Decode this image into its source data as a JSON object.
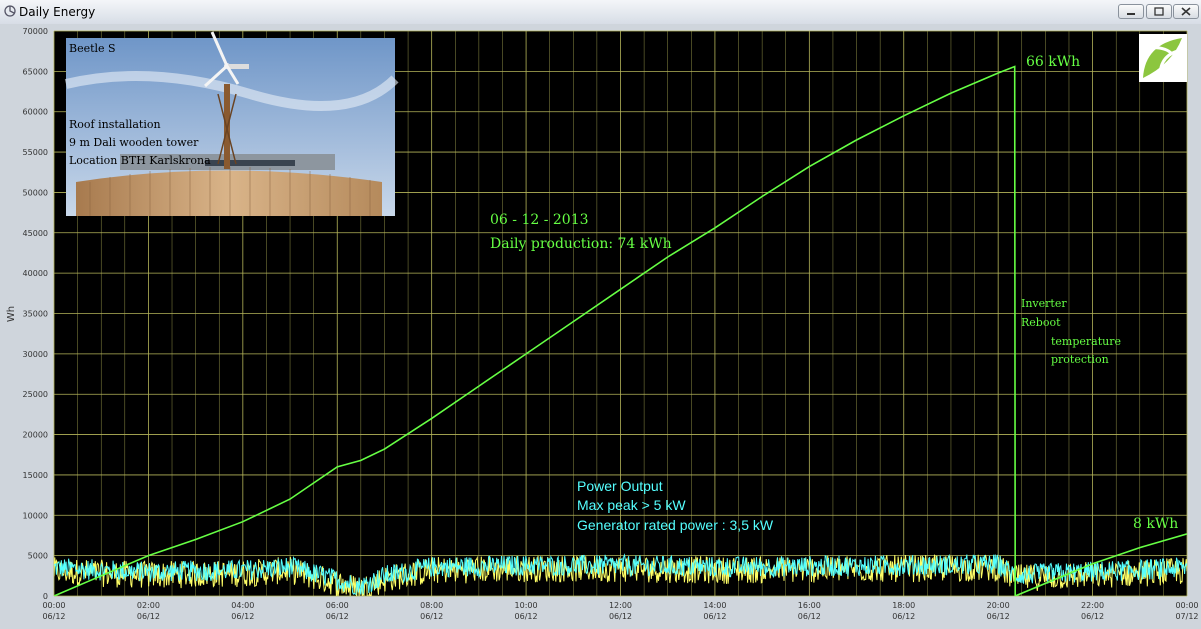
{
  "window": {
    "title": "Daily Energy",
    "minimize_icon": "minimize-icon",
    "maximize_icon": "maximize-icon",
    "close_icon": "close-icon"
  },
  "colors": {
    "plot_bg": "#000000",
    "grid": "#b5b55a",
    "energy_line": "#66ff44",
    "power_cyan": "#55ffff",
    "power_yellow": "#ffff66",
    "annotation_green": "#66ff44",
    "annotation_cyan": "#55ffff"
  },
  "photo": {
    "icon": "wind-turbine-photo",
    "caption_title": "Beetle S",
    "caption_lines": [
      "Roof installation",
      "9 m Dali wooden tower",
      "Location BTH Karlskrona"
    ]
  },
  "logo": {
    "icon": "leaf-logo-icon"
  },
  "annotations": {
    "date": "06 - 12 - 2013",
    "daily_production": "Daily production: 74 kWh",
    "peak_energy": "66 kWh",
    "end_energy": "8 kWh",
    "inverter": "Inverter",
    "reboot": "Reboot",
    "temperature": "temperature",
    "protection": "protection",
    "power_title": "Power Output",
    "max_peak": "Max peak > 5 kW",
    "rated_power": "Generator rated power : 3,5 kW"
  },
  "chart_data": {
    "type": "line",
    "ylabel": "Wh",
    "xlabel": "",
    "ylim": [
      0,
      70000
    ],
    "yticks": [
      0,
      5000,
      10000,
      15000,
      20000,
      25000,
      30000,
      35000,
      40000,
      45000,
      50000,
      55000,
      60000,
      65000,
      70000
    ],
    "x_unit": "hour of day",
    "xlim": [
      0,
      24
    ],
    "xticks": [
      {
        "x": 0,
        "label1": "00:00",
        "label2": "06/12"
      },
      {
        "x": 2,
        "label1": "02:00",
        "label2": "06/12"
      },
      {
        "x": 4,
        "label1": "04:00",
        "label2": "06/12"
      },
      {
        "x": 6,
        "label1": "06:00",
        "label2": "06/12"
      },
      {
        "x": 8,
        "label1": "08:00",
        "label2": "06/12"
      },
      {
        "x": 10,
        "label1": "10:00",
        "label2": "06/12"
      },
      {
        "x": 12,
        "label1": "12:00",
        "label2": "06/12"
      },
      {
        "x": 14,
        "label1": "14:00",
        "label2": "06/12"
      },
      {
        "x": 16,
        "label1": "16:00",
        "label2": "06/12"
      },
      {
        "x": 18,
        "label1": "18:00",
        "label2": "06/12"
      },
      {
        "x": 20,
        "label1": "20:00",
        "label2": "06/12"
      },
      {
        "x": 22,
        "label1": "22:00",
        "label2": "06/12"
      },
      {
        "x": 24,
        "label1": "00:00",
        "label2": "07/12"
      }
    ],
    "grid": true,
    "series": [
      {
        "role": "cumulative energy",
        "color": "#66ff44",
        "points": [
          [
            0,
            0
          ],
          [
            1,
            2500
          ],
          [
            2,
            5000
          ],
          [
            3,
            7000
          ],
          [
            4,
            9200
          ],
          [
            5,
            12000
          ],
          [
            6,
            16000
          ],
          [
            6.5,
            16800
          ],
          [
            7,
            18200
          ],
          [
            8,
            22000
          ],
          [
            9,
            26000
          ],
          [
            10,
            30000
          ],
          [
            11,
            34000
          ],
          [
            12,
            38000
          ],
          [
            13,
            42000
          ],
          [
            14,
            45600
          ],
          [
            15,
            49500
          ],
          [
            16,
            53200
          ],
          [
            17,
            56500
          ],
          [
            18,
            59500
          ],
          [
            19,
            62300
          ],
          [
            20,
            64800
          ],
          [
            20.35,
            65600
          ],
          [
            20.36,
            0
          ],
          [
            22,
            4000
          ],
          [
            23,
            6000
          ],
          [
            24,
            7700
          ]
        ]
      },
      {
        "role": "power output",
        "color": "#55ffff",
        "typical_range": [
          1000,
          5500
        ],
        "baseline_level": [
          [
            0,
            3500
          ],
          [
            1,
            3200
          ],
          [
            2,
            3000
          ],
          [
            4,
            3200
          ],
          [
            5,
            3600
          ],
          [
            6,
            2000
          ],
          [
            6.5,
            1200
          ],
          [
            7,
            2500
          ],
          [
            8,
            3600
          ],
          [
            10,
            3800
          ],
          [
            12,
            3800
          ],
          [
            14,
            3600
          ],
          [
            16,
            3700
          ],
          [
            18,
            3800
          ],
          [
            20,
            3900
          ],
          [
            20.36,
            2600
          ],
          [
            22,
            3000
          ],
          [
            24,
            3500
          ]
        ]
      }
    ]
  }
}
